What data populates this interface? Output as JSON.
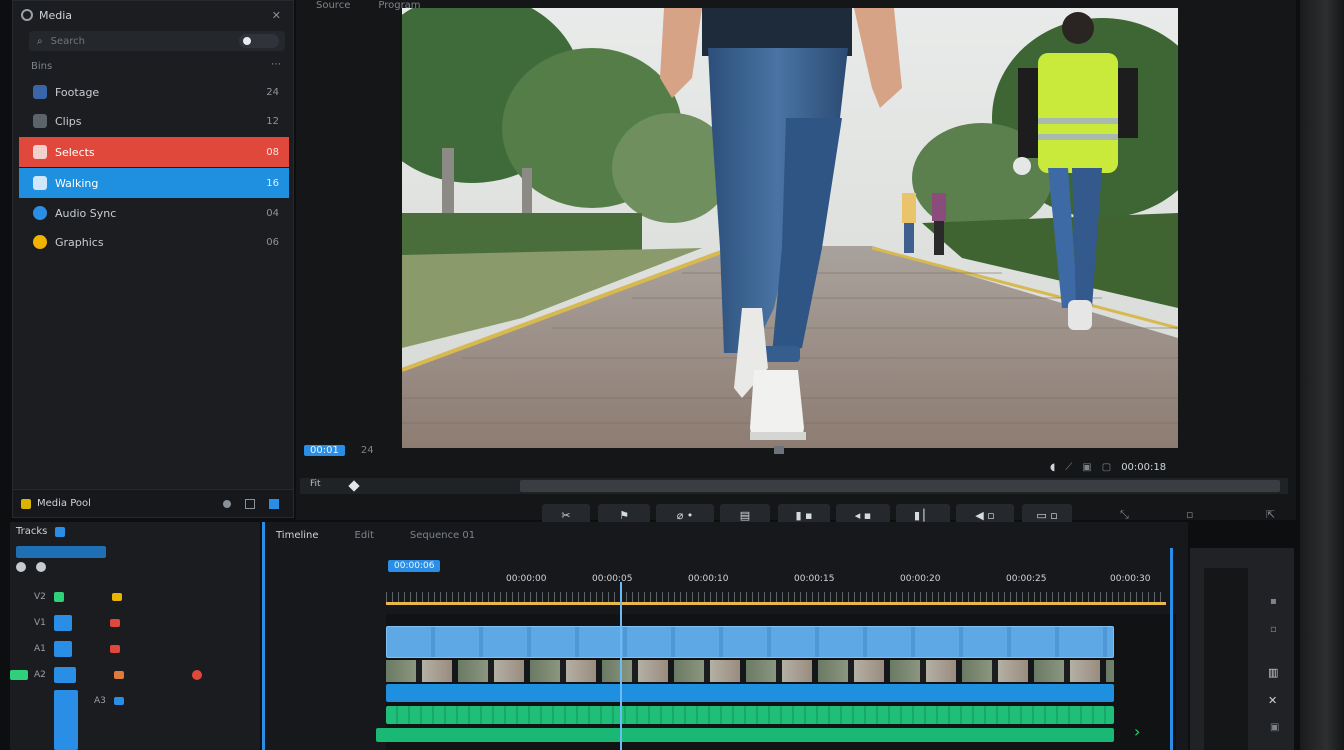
{
  "left_panel": {
    "header": "Media",
    "search": {
      "placeholder": "Search"
    },
    "section": "Bins",
    "items": [
      {
        "label": "Footage",
        "count": "24",
        "icon": "folder-icon",
        "state": "normal"
      },
      {
        "label": "Clips",
        "count": "12",
        "icon": "film-icon",
        "state": "normal"
      },
      {
        "label": "Selects",
        "count": "08",
        "icon": "clip-icon",
        "state": "selected-red"
      },
      {
        "label": "Walking",
        "count": "16",
        "icon": "video-icon",
        "state": "selected-blue"
      },
      {
        "label": "Audio Sync",
        "count": "04",
        "icon": "audio-icon",
        "state": "normal"
      },
      {
        "label": "Graphics",
        "count": "06",
        "icon": "image-icon",
        "state": "normal"
      }
    ],
    "footer": "Media Pool"
  },
  "viewer": {
    "tabs": [
      "Source",
      "Program"
    ],
    "timecode_left": "00:01",
    "fps": "24",
    "timecode_right": "00:00:18",
    "zoom": "Fit",
    "transport": [
      "Cut",
      "Mark In",
      "Mark Out",
      "Play",
      "Stop",
      "Prev",
      "Next",
      "Trim",
      "Audio",
      "Loop"
    ]
  },
  "timeline": {
    "title": "Timeline",
    "tabs": [
      "Edit",
      "Sequence 01"
    ],
    "playhead_label": "00:00:06",
    "ruler": [
      "00:00:00",
      "00:00:05",
      "00:00:10",
      "00:00:15",
      "00:00:20",
      "00:00:25",
      "00:00:30"
    ],
    "tracks": [
      "V2",
      "V1",
      "A1",
      "A2"
    ]
  },
  "tracks_panel": {
    "header": "Tracks",
    "rows": [
      "V2",
      "V1",
      "A1",
      "A2",
      "A3"
    ]
  }
}
